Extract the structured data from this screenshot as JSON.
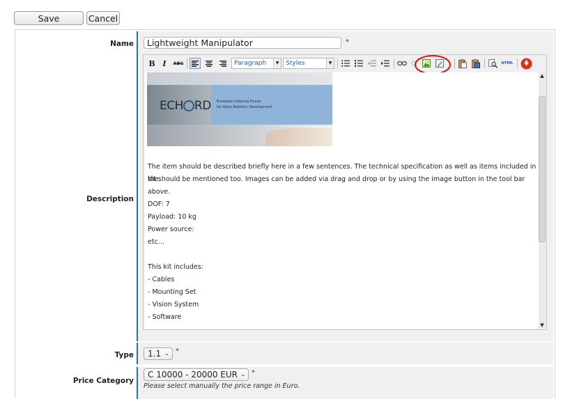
{
  "actions": {
    "save_label": "Save",
    "cancel_label": "Cancel"
  },
  "name_field": {
    "label": "Name",
    "value": "Lightweight Manipulator",
    "required": "*"
  },
  "description": {
    "label": "Description",
    "toolbar": {
      "bold": "B",
      "italic": "I",
      "strike": "ABC",
      "format_select": "Paragraph",
      "styles_select": "Styles",
      "html_label": "HTML"
    },
    "banner": {
      "logo_text": "ECH",
      "logo_text2": "RD",
      "tagline_1": "European Clearing House",
      "tagline_2": "for Open Robotics Development"
    },
    "paragraphs": [
      "The item should be described briefly here in a few sentences. The technical specification as well as items included in the",
      "kit should be mentioned too. Images can be added via drag and drop or by using the image button in the tool bar above.",
      "DOF: 7",
      "Payload: 10 kg",
      "Power source:",
      "etc...",
      "This kit includes:",
      "- Cables",
      "- Mounting Set",
      "- Vision System",
      "- Software"
    ]
  },
  "type_field": {
    "label": "Type",
    "value": "1.1",
    "required": "*"
  },
  "price_field": {
    "label": "Price Category",
    "value": "C 10000 - 20000 EUR",
    "required": "*",
    "hint": "Please select manually the price range in Euro."
  },
  "colors": {
    "accent": "#2c6cb0",
    "highlight_circle": "#e01010",
    "banner_blue": "#8fb3d9"
  }
}
